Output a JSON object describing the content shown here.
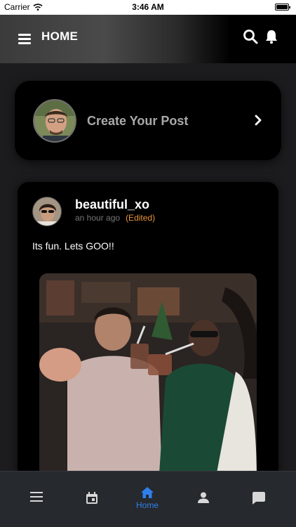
{
  "status_bar": {
    "carrier": "Carrier",
    "time": "3:46 AM"
  },
  "header": {
    "title": "HOME",
    "menu_icon": "hamburger-menu-icon",
    "search_icon": "search-icon",
    "bell_icon": "bell-icon"
  },
  "create_post": {
    "label": "Create Your Post",
    "chevron_icon": "chevron-right-icon"
  },
  "post": {
    "username": "beautiful_xo",
    "timestamp": "an hour ago",
    "edited_label": "(Edited)",
    "text": "Its fun. Lets GOO!!"
  },
  "bottom_nav": {
    "items": [
      {
        "icon": "menu-lines-icon",
        "label": ""
      },
      {
        "icon": "calendar-icon",
        "label": ""
      },
      {
        "icon": "home-icon",
        "label": "Home",
        "active": true
      },
      {
        "icon": "person-icon",
        "label": ""
      },
      {
        "icon": "chat-icon",
        "label": ""
      }
    ]
  },
  "colors": {
    "accent": "#2f80ed",
    "edited": "#e8923b",
    "card": "#000000",
    "background": "#1c1c1e"
  }
}
